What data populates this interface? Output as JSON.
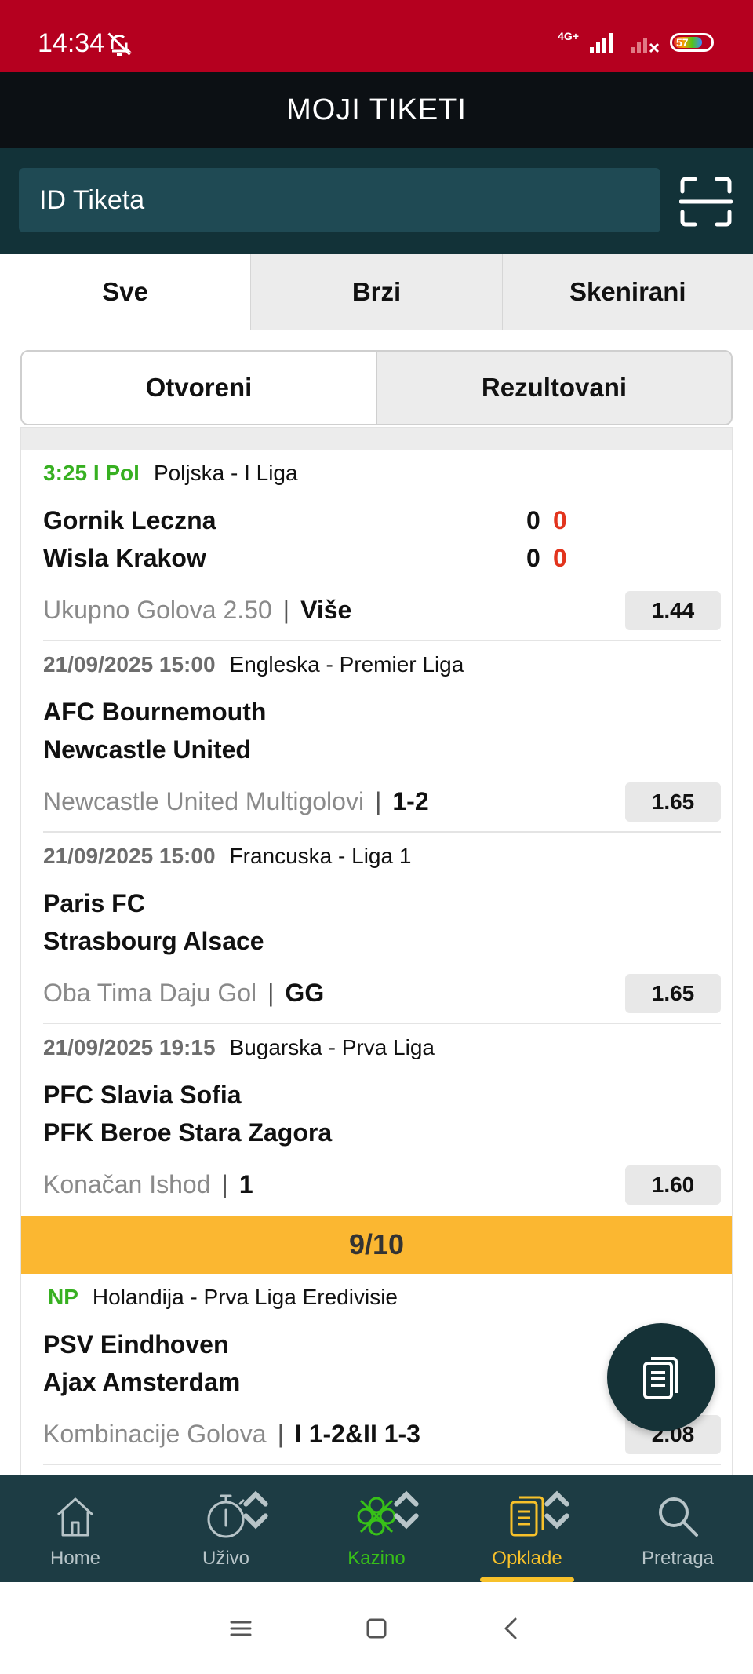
{
  "status_bar": {
    "time": "14:34",
    "network": "4G+",
    "battery": "57"
  },
  "header": {
    "title": "MOJI TIKETI"
  },
  "search": {
    "placeholder": "ID Tiketa"
  },
  "tabs": [
    {
      "label": "Sve"
    },
    {
      "label": "Brzi"
    },
    {
      "label": "Skenirani"
    }
  ],
  "segments": [
    {
      "label": "Otvoreni"
    },
    {
      "label": "Rezultovani"
    }
  ],
  "matches": [
    {
      "time": "3:25 I Pol",
      "league": "Poljska - I Liga",
      "team1": "Gornik Leczna",
      "team2": "Wisla Krakow",
      "score1": "0",
      "live1": "0",
      "score2": "0",
      "live2": "0",
      "market": "Ukupno Golova 2.50",
      "pick": "Više",
      "odd": "1.44"
    },
    {
      "time": "21/09/2025 15:00",
      "league": "Engleska - Premier Liga",
      "team1": "AFC Bournemouth",
      "team2": "Newcastle United",
      "market": "Newcastle United Multigolovi",
      "pick": "1-2",
      "odd": "1.65"
    },
    {
      "time": "21/09/2025 15:00",
      "league": "Francuska - Liga 1",
      "team1": "Paris FC",
      "team2": "Strasbourg Alsace",
      "market": "Oba Tima Daju Gol",
      "pick": "GG",
      "odd": "1.65"
    },
    {
      "time": "21/09/2025 19:15",
      "league": "Bugarska - Prva Liga",
      "team1": "PFC Slavia Sofia",
      "team2": "PFK Beroe Stara Zagora",
      "market": "Konačan Ishod",
      "pick": "1",
      "odd": "1.60"
    },
    {
      "time": "NP",
      "league": "Holandija - Prva Liga Eredivisie",
      "team1": "PSV Eindhoven",
      "team2": "Ajax Amsterdam",
      "market": "Kombinacije Golova",
      "pick": "I 1-2&II 1-3",
      "odd": "2.08"
    }
  ],
  "progress": {
    "label": "9/10"
  },
  "separator": "|",
  "bottom_nav": [
    {
      "label": "Home",
      "icon": "home-icon"
    },
    {
      "label": "Uživo",
      "icon": "stopwatch-icon"
    },
    {
      "label": "Kazino",
      "icon": "clover-icon"
    },
    {
      "label": "Opklade",
      "icon": "tickets-icon"
    },
    {
      "label": "Pretraga",
      "icon": "search-icon"
    }
  ],
  "colors": {
    "status_bar": "#b5001f",
    "header": "#0c1014",
    "search_area": "#123238",
    "live_green": "#37b021",
    "score_red": "#e2341d",
    "progress_yellow": "#fbb731",
    "nav_bg": "#1d3c44",
    "nav_active": "#f7c12a"
  }
}
